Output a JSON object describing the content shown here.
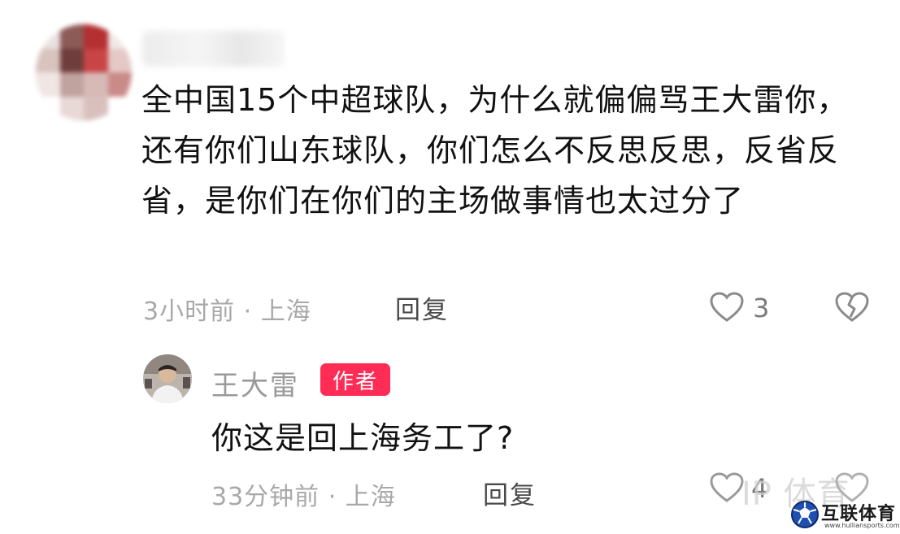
{
  "comment": {
    "text": "全中国15个中超球队，为什么就偏偏骂王大雷你，还有你们山东球队，你们怎么不反思反思，反省反省，是你们在你们的主场做事情也太过分了",
    "meta": "3小时前 · 上海",
    "reply_label": "回复",
    "likes": "3"
  },
  "reply": {
    "author": "王大雷",
    "badge": "作者",
    "text": "你这是回上海务工了?",
    "meta": "33分钟前 · 上海",
    "reply_label": "回复",
    "likes": "4"
  },
  "watermark": "IP 体育",
  "logo": {
    "text": "互联体育",
    "sub": "www.hulliansports.com"
  }
}
